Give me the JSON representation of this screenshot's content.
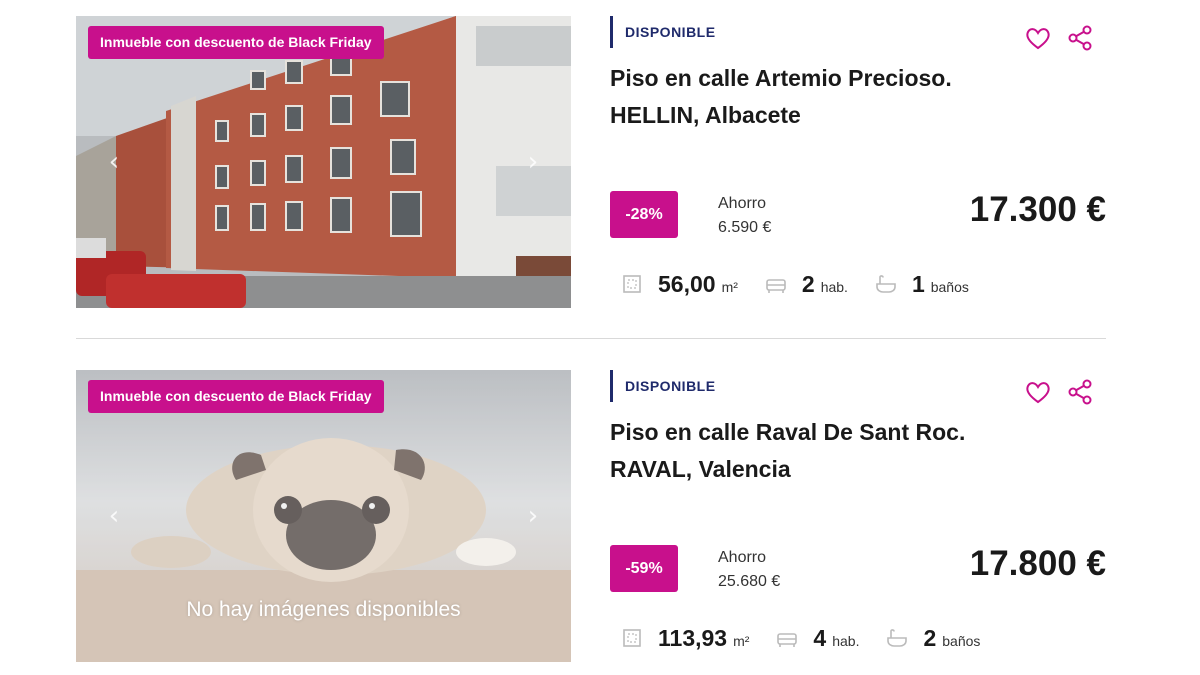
{
  "listings": [
    {
      "badge": "Inmueble con descuento de Black Friday",
      "status": "DISPONIBLE",
      "title_line1": "Piso en calle Artemio Precioso.",
      "title_line2": "HELLIN, Albacete",
      "discount": "-28%",
      "savings_label": "Ahorro",
      "savings_value": "6.590 €",
      "price": "17.300 €",
      "area": "56,00",
      "area_unit": "m²",
      "rooms": "2",
      "rooms_unit": "hab.",
      "baths": "1",
      "baths_unit": "baños",
      "image": "building-photo"
    },
    {
      "badge": "Inmueble con descuento de Black Friday",
      "status": "DISPONIBLE",
      "title_line1": "Piso en calle Raval De Sant Roc.",
      "title_line2": "RAVAL, Valencia",
      "discount": "-59%",
      "savings_label": "Ahorro",
      "savings_value": "25.680 €",
      "price": "17.800 €",
      "area": "113,93",
      "area_unit": "m²",
      "rooms": "4",
      "rooms_unit": "hab.",
      "baths": "2",
      "baths_unit": "baños",
      "image": "pug-placeholder",
      "no_image_text": "No hay imágenes disponibles"
    }
  ],
  "colors": {
    "accent": "#c8108c",
    "status_navy": "#1f2a6b",
    "divider": "#d9d9d9"
  },
  "icons": [
    "heart-icon",
    "share-icon",
    "area-icon",
    "bed-icon",
    "bath-icon",
    "chevron-left-icon",
    "chevron-right-icon"
  ]
}
